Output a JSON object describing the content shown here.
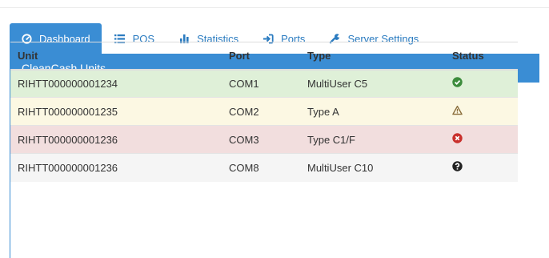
{
  "nav": {
    "tabs": [
      {
        "label": "Dashboard",
        "icon": "dashboard-icon",
        "active": true
      },
      {
        "label": "POS",
        "icon": "list-icon",
        "active": false
      },
      {
        "label": "Statistics",
        "icon": "bar-chart-icon",
        "active": false
      },
      {
        "label": "Ports",
        "icon": "sign-in-icon",
        "active": false
      },
      {
        "label": "Server Settings",
        "icon": "wrench-icon",
        "active": false
      }
    ]
  },
  "panel": {
    "title": "CleanCash Units"
  },
  "table": {
    "headers": [
      "Unit",
      "Port",
      "Type",
      "Status"
    ],
    "rows": [
      {
        "unit": "RIHTT000000001234",
        "port": "COM1",
        "type": "MultiUser C5",
        "status": "ok",
        "status_icon": "check-circle-icon"
      },
      {
        "unit": "RIHTT000000001235",
        "port": "COM2",
        "type": "Type A",
        "status": "warning",
        "status_icon": "warning-icon"
      },
      {
        "unit": "RIHTT000000001236",
        "port": "COM3",
        "type": "Type C1/F",
        "status": "error",
        "status_icon": "times-circle-icon"
      },
      {
        "unit": "RIHTT000000001236",
        "port": "COM8",
        "type": "MultiUser C10",
        "status": "unknown",
        "status_icon": "question-circle-icon"
      }
    ]
  },
  "colors": {
    "accent": "#3a8dd4",
    "link": "#2a7bc0",
    "success_row": "#dff0d8",
    "warning_row": "#fcf8e3",
    "danger_row": "#f2dede",
    "neutral_row": "#f5f5f5",
    "success_icon": "#3c8c3c",
    "warning_icon": "#8a6d3b",
    "danger_icon": "#c9302c"
  }
}
